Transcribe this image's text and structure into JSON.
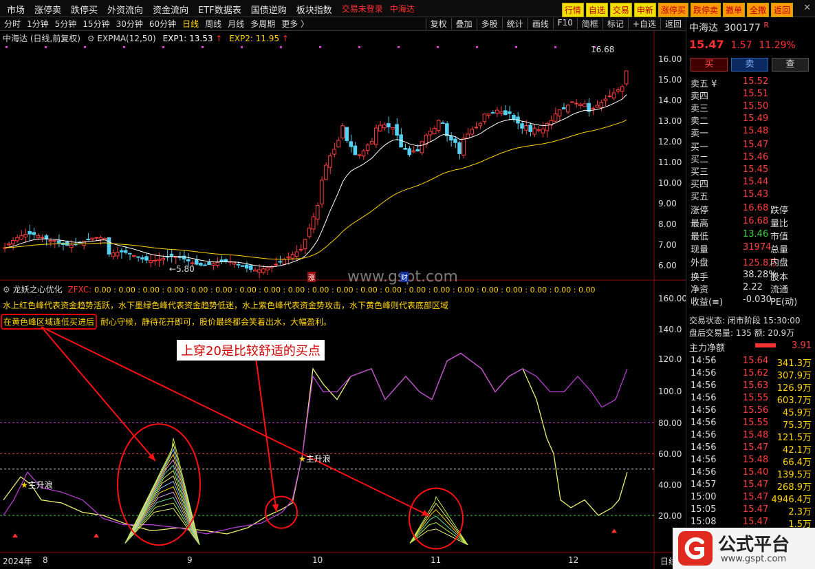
{
  "topmenu": [
    "市场",
    "涨停卖",
    "跌停买",
    "外资流向",
    "资金流向",
    "ETF数据表",
    "国债逆购",
    "板块指数"
  ],
  "login_hint": "交易未登录",
  "stock_hint": "中海达",
  "topbuttons": [
    "行情",
    "自选",
    "交易",
    "申新",
    "涨停买",
    "跌停卖",
    "撤单",
    "全撤",
    "返回"
  ],
  "periods": [
    "分时",
    "1分钟",
    "5分钟",
    "15分钟",
    "30分钟",
    "60分钟",
    "日线",
    "周线",
    "月线",
    "多周期",
    "更多 〉"
  ],
  "active_period": "日线",
  "tools": [
    "复权",
    "叠加",
    "多股",
    "统计",
    "画线",
    "F10",
    "简框",
    "标记",
    "+自选",
    "返回"
  ],
  "main_title": {
    "name": "中海达 (日线,前复权)",
    "indicator": "EXPMA(12,50)",
    "exp1": "EXP1: 13.53",
    "exp2": "EXP2: 11.95",
    "up_arrow": "↑"
  },
  "price_axis": [
    "16.00",
    "15.00",
    "14.00",
    "13.00",
    "12.00",
    "11.00",
    "10.00",
    "9.00",
    "8.00",
    "7.00",
    "6.00"
  ],
  "high_label": "16.68",
  "low_label": "5.80",
  "watermark_text": "www.gspt.com",
  "event_marks": [
    "涨",
    "财"
  ],
  "sub_title": {
    "name": "龙妖之心优化",
    "tag": "ZFXC:",
    "values": "0.00 : 0.00 : 0.00 : 0.00 : 0.00 : 0.00 : 0.00 : 0.00 : 0.00 : 0.00 : 0.00 : 0.00 : 0.00 : 0.00 : 0.00 : 0.00 : 0.00 : 0.00 : 0.00 : 0.00 : 0.00"
  },
  "desc_line": "水上红色峰代表资金趋势活跃，水下墨绿色峰代表资金趋势低迷，水上紫色峰代表资金势攻击，水下黄色峰则代表底部区域",
  "desc_box": "在黄色峰区域逢低买进后",
  "desc_tail": "耐心守候，静待花开即可，股价最终都会笑着出水，大幅盈利。",
  "callout": "上穿20是比较舒适的买点",
  "wave_labels": [
    "主升浪",
    "主升浪"
  ],
  "sub_axis": [
    "160.00",
    "140.0",
    "120.0",
    "100.0",
    "80.00",
    "60.00",
    "40.00",
    "20.00"
  ],
  "date_axis": [
    "2024年",
    "8",
    "9",
    "10",
    "11",
    "12",
    "日线"
  ],
  "quote": {
    "name": "中海达",
    "code": "300177",
    "flag": "R",
    "price": "15.47",
    "change": "1.57",
    "pct": "11.29%",
    "buy": "买",
    "sell": "卖",
    "query": "查"
  },
  "asks": [
    {
      "k": "卖五 ¥",
      "v": "15.52"
    },
    {
      "k": "卖四",
      "v": "15.51"
    },
    {
      "k": "卖三",
      "v": "15.50"
    },
    {
      "k": "卖二",
      "v": "15.49"
    },
    {
      "k": "卖一",
      "v": "15.48"
    }
  ],
  "bids": [
    {
      "k": "买一",
      "v": "15.47"
    },
    {
      "k": "买二",
      "v": "15.46"
    },
    {
      "k": "买三",
      "v": "15.45"
    },
    {
      "k": "买四",
      "v": "15.44"
    },
    {
      "k": "买五",
      "v": "15.43"
    }
  ],
  "stats": [
    {
      "k": "涨停",
      "v": "16.68",
      "k2": "跌停"
    },
    {
      "k": "最高",
      "v": "16.68",
      "k2": "量比"
    },
    {
      "k": "最低",
      "v": "13.46",
      "k2": "市值"
    },
    {
      "k": "现量",
      "v": "31974",
      "k2": "总量"
    },
    {
      "k": "外盘",
      "v": "125.8万",
      "k2": "内盘"
    }
  ],
  "stats2": [
    {
      "k": "换手",
      "v": "38.28%",
      "k2": "股本"
    },
    {
      "k": "净资",
      "v": "2.22",
      "k2": "流通"
    },
    {
      "k": "收益(≡)",
      "v": "-0.030",
      "k2": "PE(动)"
    }
  ],
  "trade_status": "交易状态: 闭市阶段 15:30:00",
  "after_trade": "盘后交易量: 135  额: 20.9万",
  "net_label": "主力净额",
  "net_value": "3.91",
  "ticks": [
    {
      "t": "14:56",
      "p": "15.64",
      "v": "341.3万"
    },
    {
      "t": "14:56",
      "p": "15.62",
      "v": "307.9万"
    },
    {
      "t": "14:56",
      "p": "15.63",
      "v": "126.9万"
    },
    {
      "t": "14:56",
      "p": "15.55",
      "v": "603.7万"
    },
    {
      "t": "14:56",
      "p": "15.56",
      "v": "45.9万"
    },
    {
      "t": "14:56",
      "p": "15.55",
      "v": "75.3万"
    },
    {
      "t": "14:56",
      "p": "15.48",
      "v": "121.5万"
    },
    {
      "t": "14:56",
      "p": "15.47",
      "v": "42.1万"
    },
    {
      "t": "14:56",
      "p": "15.48",
      "v": "66.4万"
    },
    {
      "t": "14:56",
      "p": "15.40",
      "v": "139.5万"
    },
    {
      "t": "14:57",
      "p": "15.47",
      "v": "268.9万"
    },
    {
      "t": "15:00",
      "p": "15.47",
      "v": "4946.4万"
    },
    {
      "t": "15:05",
      "p": "15.47",
      "v": "2.3万"
    },
    {
      "t": "15:08",
      "p": "15.47",
      "v": "1.5万"
    }
  ],
  "logo_text": "公式平台",
  "logo_url": "www.gspt.com"
}
